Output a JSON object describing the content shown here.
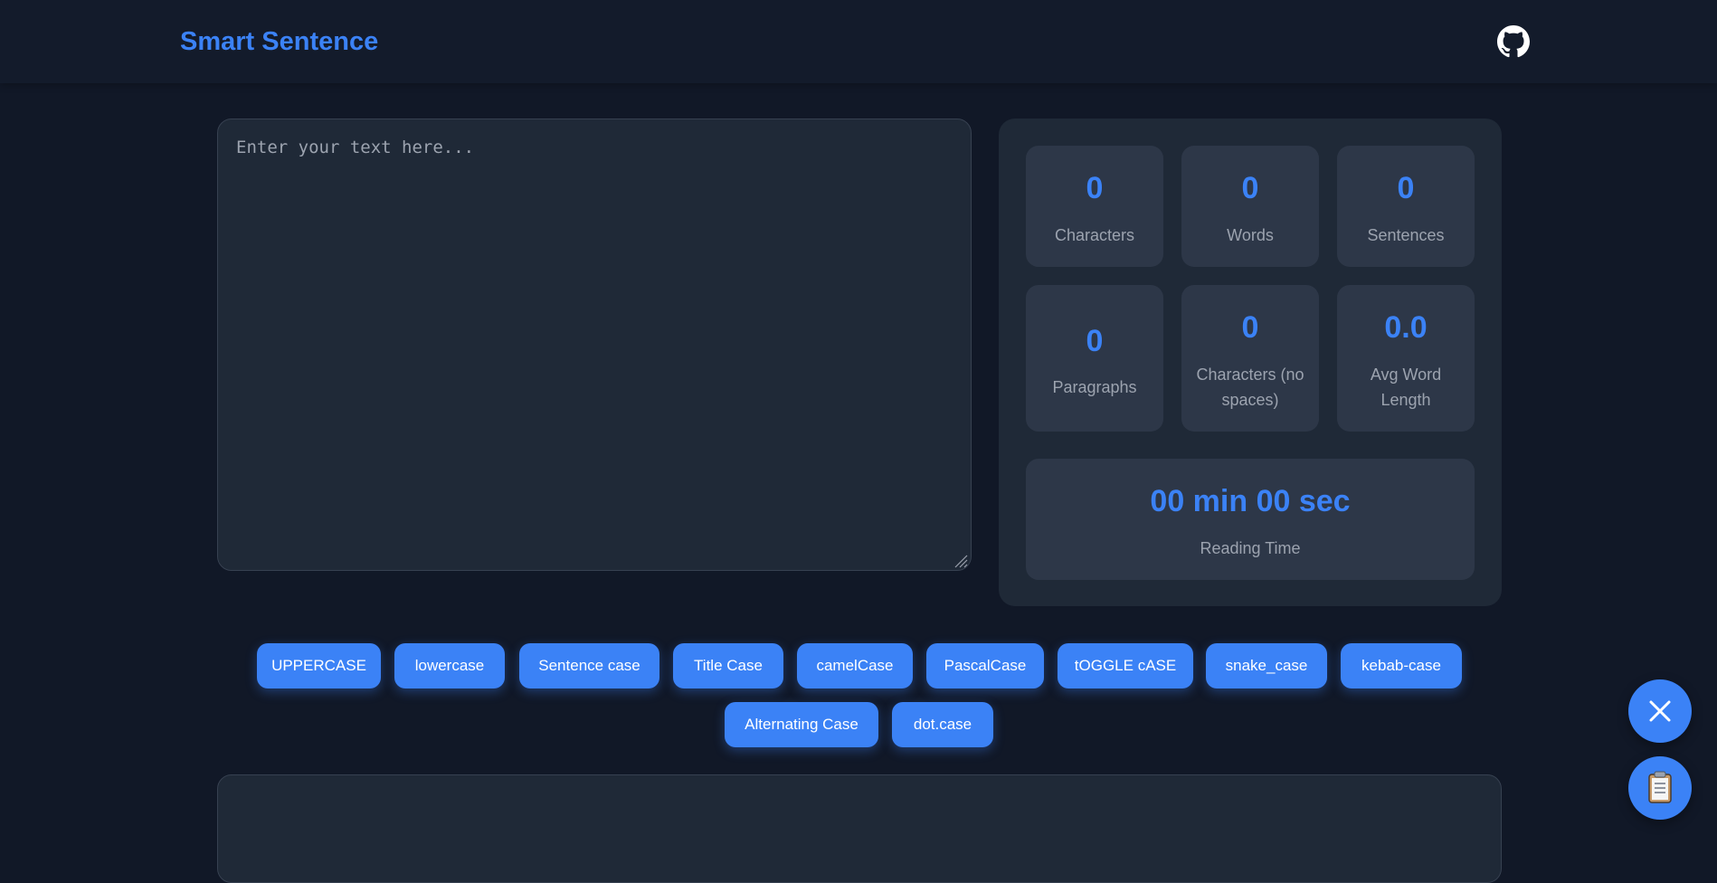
{
  "app": {
    "title": "Smart Sentence"
  },
  "header": {
    "github_icon": "github-icon"
  },
  "editor": {
    "placeholder": "Enter your text here...",
    "value": ""
  },
  "stats": [
    {
      "value": "0",
      "label": "Characters"
    },
    {
      "value": "0",
      "label": "Words"
    },
    {
      "value": "0",
      "label": "Sentences"
    },
    {
      "value": "0",
      "label": "Paragraphs"
    },
    {
      "value": "0",
      "label": "Characters (no spaces)"
    },
    {
      "value": "0.0",
      "label": "Avg Word Length"
    }
  ],
  "reading_time": {
    "value": "00 min 00 sec",
    "label": "Reading Time"
  },
  "case_buttons": [
    "UPPERCASE",
    "lowercase",
    "Sentence case",
    "Title Case",
    "camelCase",
    "PascalCase",
    "tOGGLE cASE",
    "snake_case",
    "kebab-case",
    "Alternating Case",
    "dot.case"
  ],
  "fabs": {
    "close_icon": "close-icon",
    "clipboard_icon": "clipboard-icon"
  },
  "colors": {
    "accent": "#3b82f6",
    "background": "#111827",
    "panel": "#1f2937",
    "card": "#2d3748"
  }
}
